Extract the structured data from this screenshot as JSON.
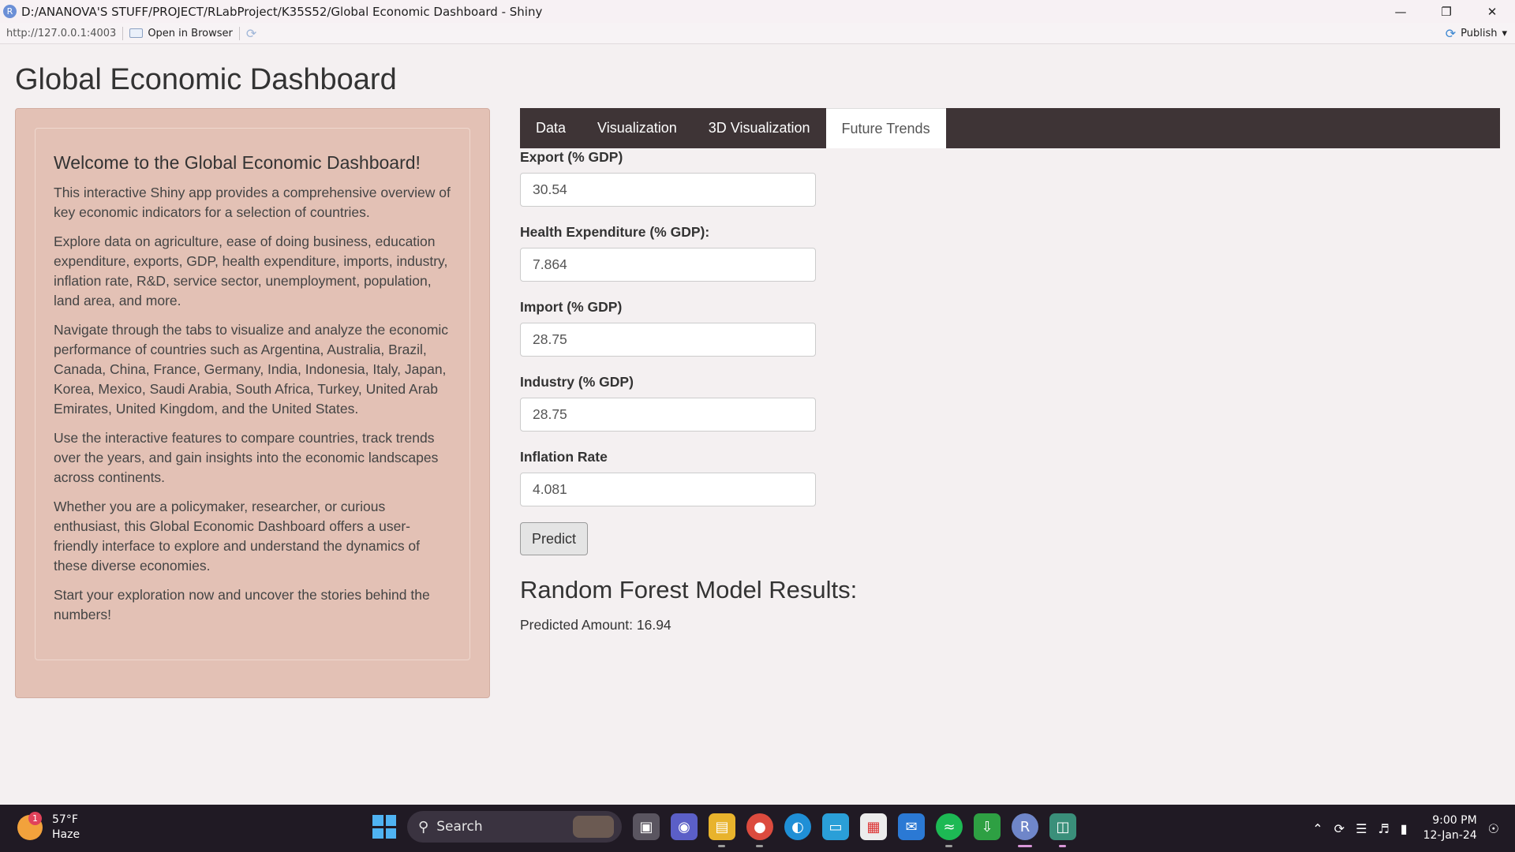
{
  "window": {
    "title": "D:/ANANOVA'S STUFF/PROJECT/RLabProject/K35S52/Global Economic Dashboard - Shiny",
    "logo": "R"
  },
  "toolbar": {
    "url": "http://127.0.0.1:4003",
    "open_in_browser": "Open in Browser",
    "publish": "Publish"
  },
  "app": {
    "title": "Global Economic Dashboard"
  },
  "sidebar": {
    "heading": "Welcome to the Global Economic Dashboard!",
    "paragraphs": [
      "This interactive Shiny app provides a comprehensive overview of key economic indicators for a selection of countries.",
      "Explore data on agriculture, ease of doing business, education expenditure, exports, GDP, health expenditure, imports, industry, inflation rate, R&D, service sector, unemployment, population, land area, and more.",
      "Navigate through the tabs to visualize and analyze the economic performance of countries such as Argentina, Australia, Brazil, Canada, China, France, Germany, India, Indonesia, Italy, Japan, Korea, Mexico, Saudi Arabia, South Africa, Turkey, United Arab Emirates, United Kingdom, and the United States.",
      "Use the interactive features to compare countries, track trends over the years, and gain insights into the economic landscapes across continents.",
      "Whether you are a policymaker, researcher, or curious enthusiast, this Global Economic Dashboard offers a user-friendly interface to explore and understand the dynamics of these diverse economies.",
      "Start your exploration now and uncover the stories behind the numbers!"
    ]
  },
  "tabs": [
    {
      "label": "Data",
      "active": false
    },
    {
      "label": "Visualization",
      "active": false
    },
    {
      "label": "3D Visualization",
      "active": false
    },
    {
      "label": "Future Trends",
      "active": true
    }
  ],
  "form": {
    "fields": [
      {
        "label": "Export (% GDP)",
        "value": "30.54"
      },
      {
        "label": "Health Expenditure (% GDP):",
        "value": "7.864"
      },
      {
        "label": "Import (% GDP)",
        "value": "28.75"
      },
      {
        "label": "Industry (% GDP)",
        "value": "28.75"
      },
      {
        "label": "Inflation Rate",
        "value": "4.081"
      }
    ],
    "predict_label": "Predict"
  },
  "results": {
    "title": "Random Forest Model Results:",
    "text": "Predicted Amount: 16.94"
  },
  "taskbar": {
    "weather_temp": "57°F",
    "weather_desc": "Haze",
    "weather_badge": "1",
    "search_label": "Search",
    "time": "9:00 PM",
    "date": "12-Jan-24"
  },
  "colors": {
    "sidebar_bg": "#e3c1b5",
    "tabbar_bg": "#3e3436",
    "page_bg": "#f4f0f1",
    "taskbar_bg": "#201a24"
  }
}
